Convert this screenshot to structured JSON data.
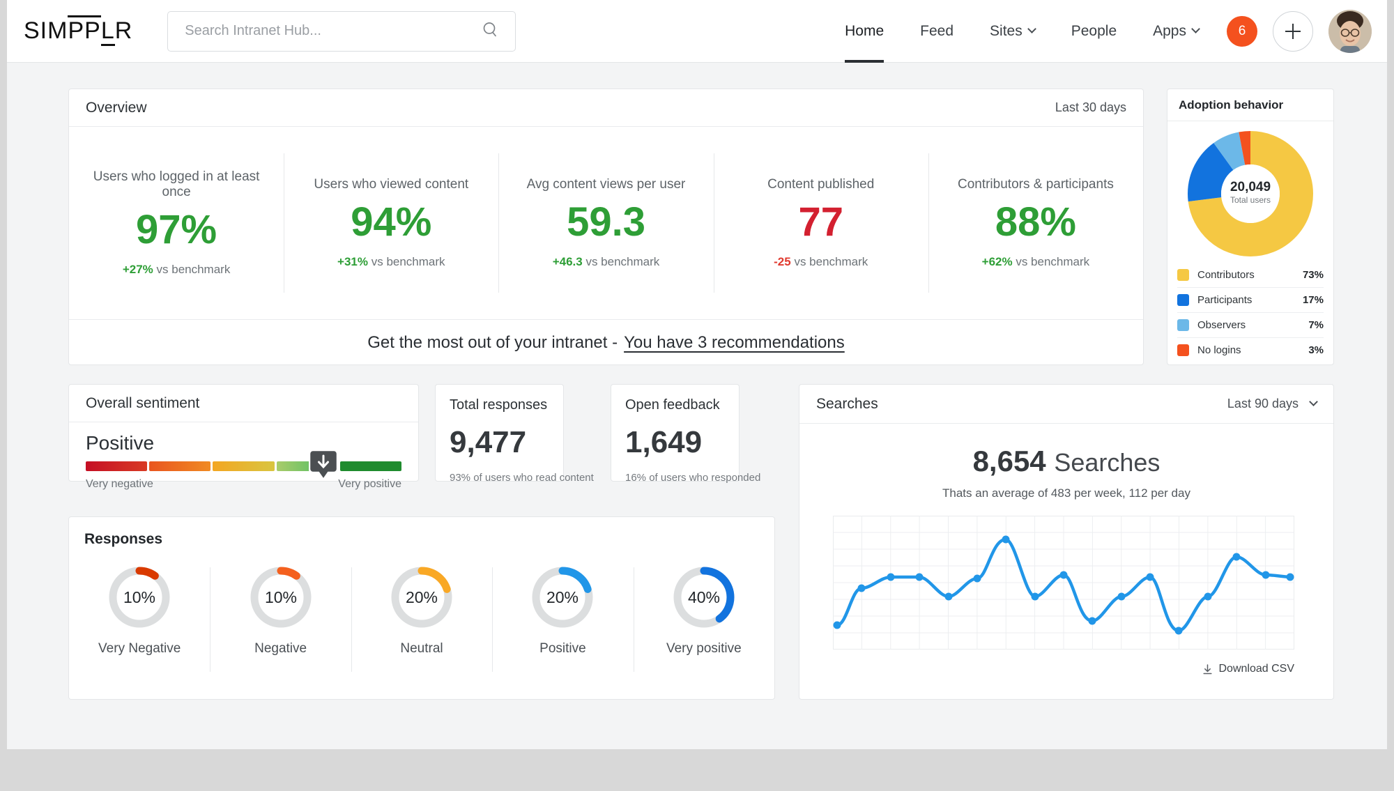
{
  "header": {
    "logo": "SIMPPLR",
    "search_placeholder": "Search Intranet Hub...",
    "nav": [
      {
        "label": "Home",
        "active": true,
        "caret": false
      },
      {
        "label": "Feed",
        "active": false,
        "caret": false
      },
      {
        "label": "Sites",
        "active": false,
        "caret": true
      },
      {
        "label": "People",
        "active": false,
        "caret": false
      },
      {
        "label": "Apps",
        "active": false,
        "caret": true
      }
    ],
    "notification_count": "6"
  },
  "overview": {
    "title": "Overview",
    "period": "Last 30 days",
    "kpis": [
      {
        "label": "Users who logged in at least once",
        "value": "97%",
        "direction": "up",
        "delta": "+27%",
        "bench": " vs benchmark"
      },
      {
        "label": "Users who viewed content",
        "value": "94%",
        "direction": "up",
        "delta": "+31%",
        "bench": " vs benchmark"
      },
      {
        "label": "Avg content views per user",
        "value": "59.3",
        "direction": "up",
        "delta": "+46.3",
        "bench": " vs benchmark"
      },
      {
        "label": "Content published",
        "value": "77",
        "direction": "down",
        "delta": "-25",
        "bench": " vs benchmark"
      },
      {
        "label": "Contributors & participants",
        "value": "88%",
        "direction": "up",
        "delta": "+62%",
        "bench": " vs benchmark"
      }
    ],
    "recommendation_prefix": "Get the most out of your intranet -",
    "recommendation_link": "You have 3 recommendations"
  },
  "adoption": {
    "title": "Adoption behavior",
    "center_value": "20,049",
    "center_label": "Total users",
    "chart_data": {
      "type": "pie",
      "title": "Adoption behavior",
      "labels": [
        "Contributors",
        "Participants",
        "Observers",
        "No logins"
      ],
      "values": [
        73,
        17,
        7,
        3
      ],
      "value_labels": [
        "73%",
        "17%",
        "7%",
        "3%"
      ],
      "colors": [
        "#f5c843",
        "#1273de",
        "#6cb8e8",
        "#f4511e"
      ],
      "total": "20,049",
      "total_label": "Total users",
      "legend": "bottom"
    }
  },
  "sentiment": {
    "title": "Overall sentiment",
    "value": "Positive",
    "marker_position_pct": 75,
    "scale_min_label": "Very negative",
    "scale_max_label": "Very positive",
    "segment_colors": [
      "#d4102a",
      "#ef6a1e",
      "#f6b825",
      "#7cc576",
      "#1f8b2e"
    ]
  },
  "total_responses": {
    "title": "Total responses",
    "value": "9,477",
    "note": "93% of users who read content"
  },
  "open_feedback": {
    "title": "Open feedback",
    "value": "1,649",
    "note": "16% of users who responded"
  },
  "responses": {
    "title": "Responses",
    "chart_data": {
      "type": "pie",
      "title": "Responses",
      "categories": [
        "Very Negative",
        "Negative",
        "Neutral",
        "Positive",
        "Very positive"
      ],
      "values": [
        10,
        10,
        20,
        20,
        40
      ],
      "value_labels": [
        "10%",
        "10%",
        "20%",
        "20%",
        "40%"
      ],
      "colors": [
        "#d93a00",
        "#f4601e",
        "#f9a825",
        "#2196e8",
        "#1273de"
      ]
    }
  },
  "searches": {
    "title": "Searches",
    "period": "Last 90 days",
    "total": "8,654",
    "total_suffix": "Searches",
    "average_note": "Thats an average of 483 per week, 112 per day",
    "download_label": "Download CSV",
    "chart_data": {
      "type": "line",
      "title": "Searches",
      "xlabel": "",
      "ylabel": "",
      "grid": true,
      "legend": "none",
      "line_color": "#2196e8",
      "x": [
        1,
        2,
        3,
        4,
        5,
        6,
        7,
        8,
        9,
        10,
        11,
        12,
        13,
        14,
        15,
        16,
        17
      ],
      "values": [
        18,
        46,
        56,
        56,
        44,
        55,
        82,
        44,
        57,
        22,
        44,
        56,
        13,
        44,
        66,
        63,
        56
      ],
      "ylim": [
        0,
        100
      ]
    }
  }
}
